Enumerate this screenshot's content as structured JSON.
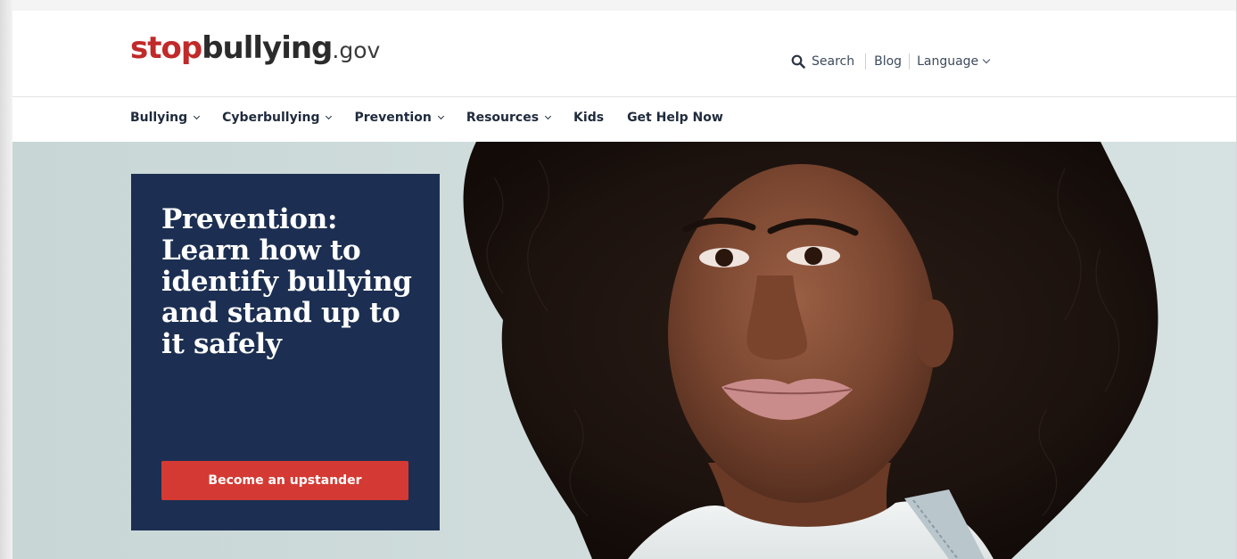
{
  "logo": {
    "part_stop": "stop",
    "part_bullying": "bullying",
    "part_gov": ".gov"
  },
  "utility": {
    "search_label": "Search",
    "blog_label": "Blog",
    "language_label": "Language"
  },
  "nav": {
    "items": [
      {
        "label": "Bullying",
        "has_dropdown": true
      },
      {
        "label": "Cyberbullying",
        "has_dropdown": true
      },
      {
        "label": "Prevention",
        "has_dropdown": true
      },
      {
        "label": "Resources",
        "has_dropdown": true
      },
      {
        "label": "Kids",
        "has_dropdown": false
      },
      {
        "label": "Get Help Now",
        "has_dropdown": false
      }
    ]
  },
  "hero": {
    "heading": "Prevention: Learn how to identify bullying and stand up to it safely",
    "cta_label": "Become an upstander"
  },
  "icons": {
    "search": "search-icon",
    "dropdown": "chevron-down-icon"
  },
  "colors": {
    "brand_red": "#c12a2a",
    "card_navy": "#1c2f52",
    "cta_red": "#d43a33",
    "nav_text": "#1f2a3c"
  }
}
